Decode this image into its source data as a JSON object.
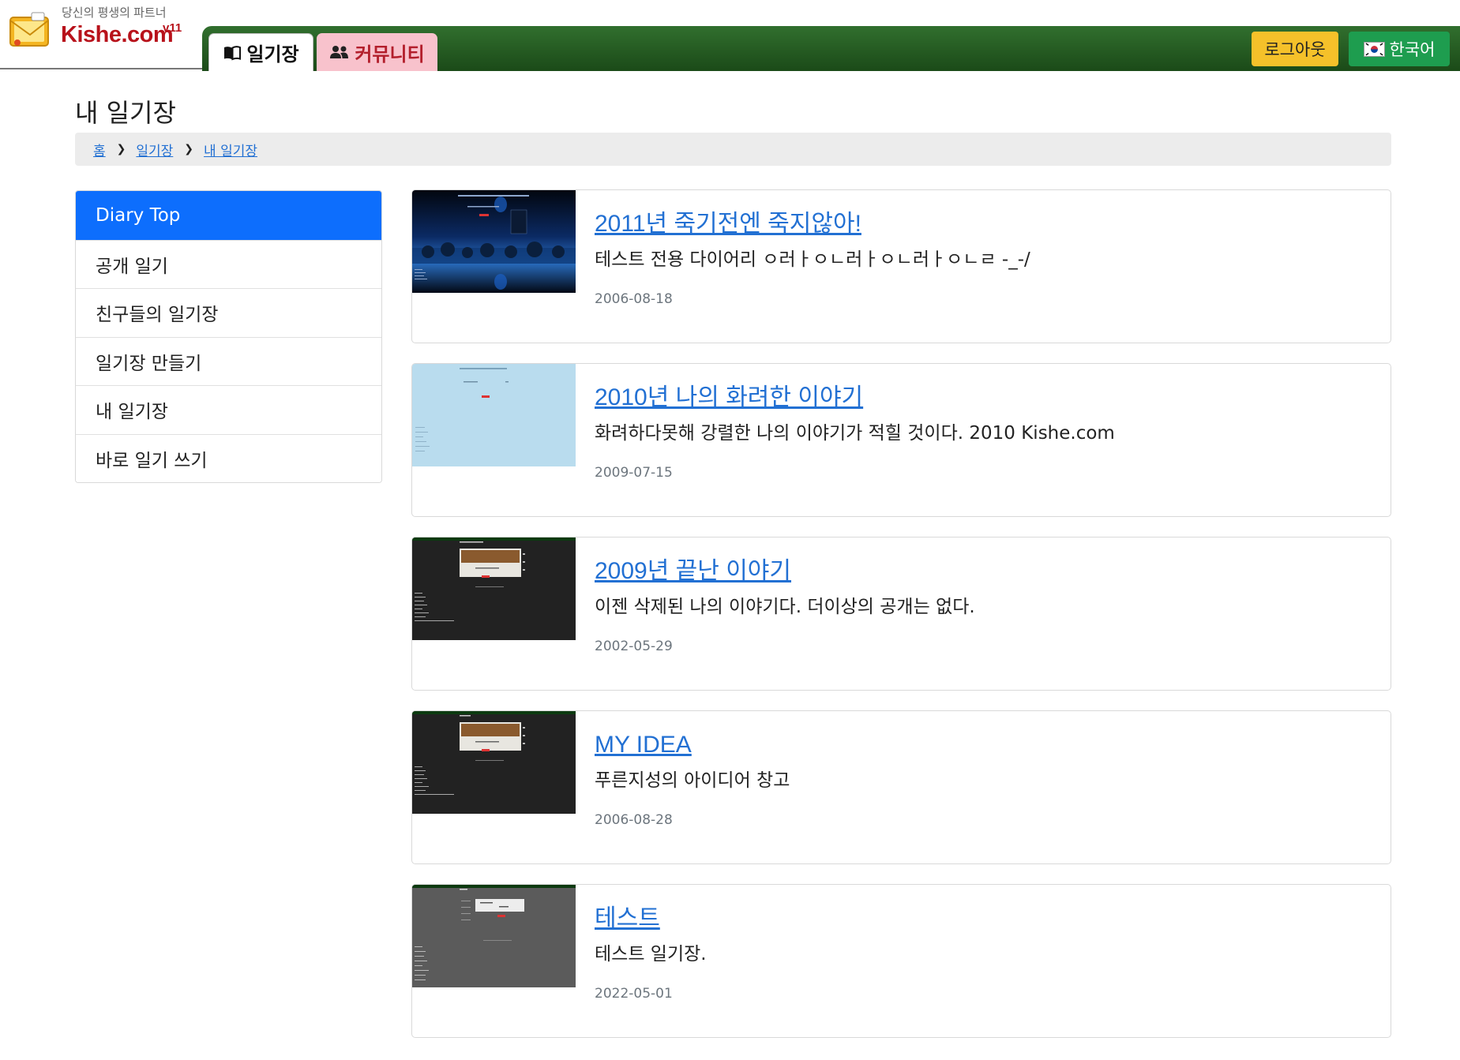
{
  "header": {
    "tagline": "당신의 평생의 파트너",
    "brand": "Kishe.com",
    "version": "v11",
    "tabs": [
      {
        "label": "일기장",
        "icon": "book-icon",
        "active": true
      },
      {
        "label": "커뮤니티",
        "icon": "users-icon",
        "active": false
      }
    ],
    "logout_label": "로그아웃",
    "language_label": "한국어",
    "colors": {
      "nav_dark": "#1b4a18",
      "nav_light": "#316f2e",
      "logout": "#f5c12a",
      "language": "#1e9d4f",
      "community_tab": "#f8c2cc",
      "brand": "#b8121b"
    }
  },
  "page": {
    "title": "내 일기장",
    "breadcrumb": [
      "홈",
      "일기장",
      "내 일기장"
    ]
  },
  "sidebar": {
    "accent": "#0d6efd",
    "items": [
      {
        "label": "Diary Top",
        "active": true
      },
      {
        "label": "공개 일기",
        "active": false
      },
      {
        "label": "친구들의 일기장",
        "active": false
      },
      {
        "label": "일기장 만들기",
        "active": false
      },
      {
        "label": "내 일기장",
        "active": false
      },
      {
        "label": "바로 일기 쓰기",
        "active": false
      }
    ]
  },
  "diaries": [
    {
      "title": "2011년 죽기전엔 죽지않아!",
      "description": "테스트 전용 다이어리 ㅇ러ㅏㅇㄴ러ㅏㅇㄴ러ㅏㅇㄴㄹ -_-/",
      "date": "2006-08-18",
      "thumbnail_theme": "dark-blue-winter"
    },
    {
      "title": "2010년 나의 화려한 이야기",
      "description": "화려하다못해 강렬한 나의 이야기가 적힐 것이다. 2010 Kishe.com",
      "date": "2009-07-15",
      "thumbnail_theme": "light-blue"
    },
    {
      "title": "2009년 끝난 이야기",
      "description": "이젠 삭제된 나의 이야기다. 더이상의 공개는 없다.",
      "date": "2002-05-29",
      "thumbnail_theme": "dark-gray-brown"
    },
    {
      "title": "MY IDEA",
      "description": "푸른지성의 아이디어 창고",
      "date": "2006-08-28",
      "thumbnail_theme": "dark-gray-brown"
    },
    {
      "title": "테스트",
      "description": "테스트 일기장.",
      "date": "2022-05-01",
      "thumbnail_theme": "gray"
    }
  ]
}
